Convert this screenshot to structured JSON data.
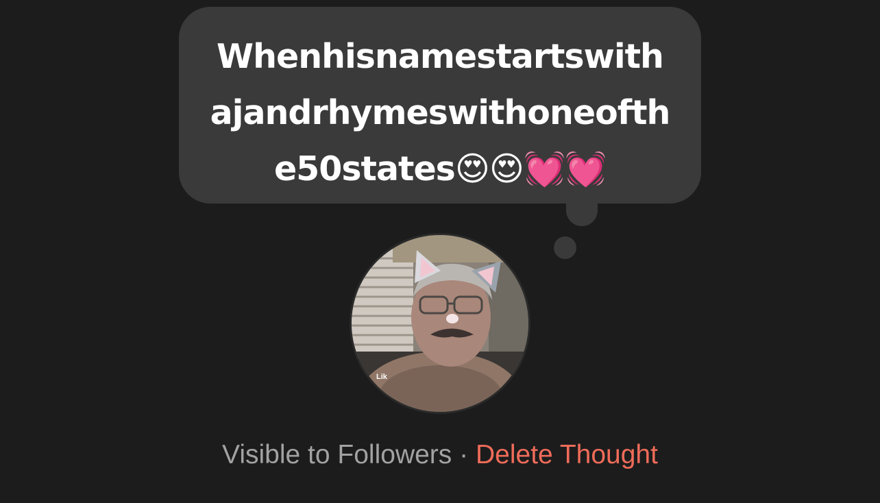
{
  "thought": {
    "text": "Whenhisnamestartswithajandrhymeswithoneofthe50states😍😍💓💓"
  },
  "avatar": {
    "overlay_text": "Lik"
  },
  "footer": {
    "visibility_label": "Visible to Followers",
    "separator": "·",
    "delete_label": "Delete Thought"
  },
  "colors": {
    "background": "#1c1c1c",
    "bubble": "#3a3a3a",
    "delete_accent": "#f06c5a",
    "muted_text": "#a2a2a2"
  }
}
